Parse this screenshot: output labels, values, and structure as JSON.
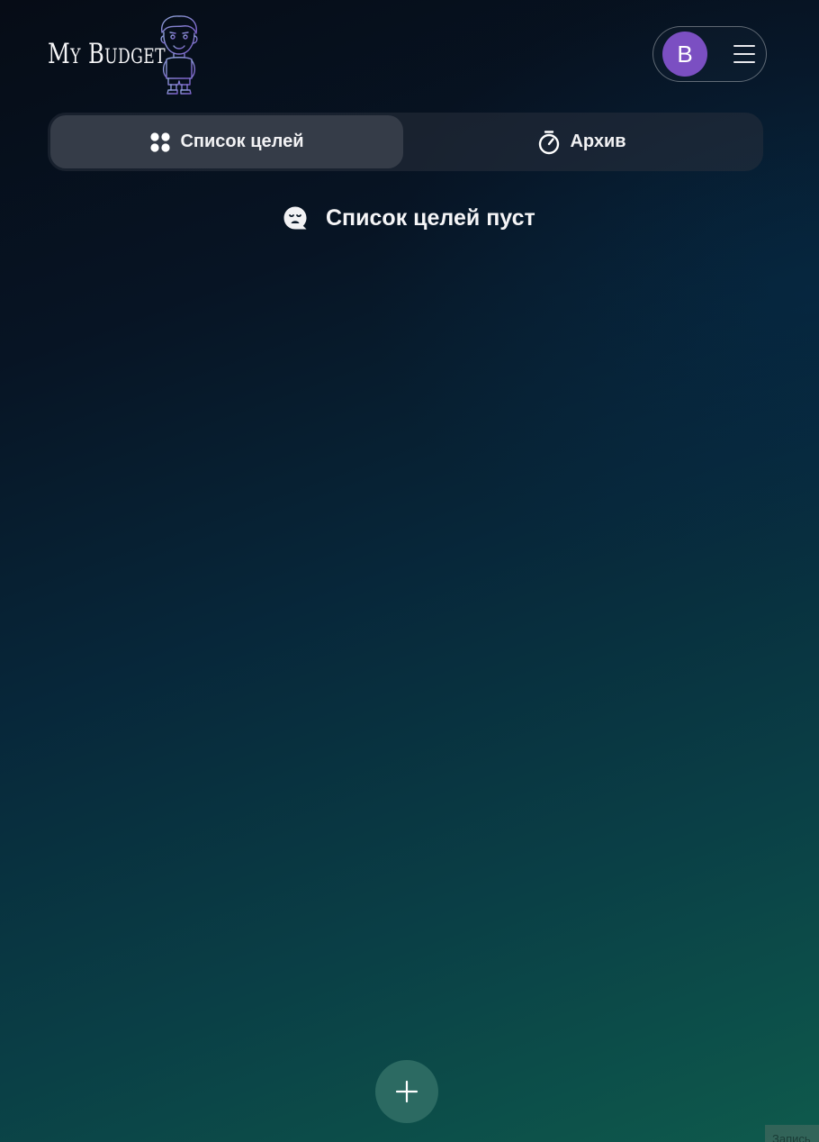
{
  "header": {
    "logo_text": "My Budget",
    "user": {
      "avatar_letter": "B",
      "avatar_color": "#7b4fc2"
    },
    "menu_icon": "hamburger-menu-icon"
  },
  "tabs": [
    {
      "label": "Список целей",
      "icon": "four-dots-icon",
      "active": true
    },
    {
      "label": "Архив",
      "icon": "stopwatch-icon",
      "active": false
    }
  ],
  "empty_state": {
    "icon": "sad-face-bubble-icon",
    "text": "Список целей пуст"
  },
  "fab": {
    "icon": "plus-icon"
  },
  "corner_badge": {
    "text": "Запись"
  },
  "colors": {
    "accent_purple": "#7b4fc2",
    "active_tab": "#353c48",
    "fab": "#2c6a62"
  }
}
